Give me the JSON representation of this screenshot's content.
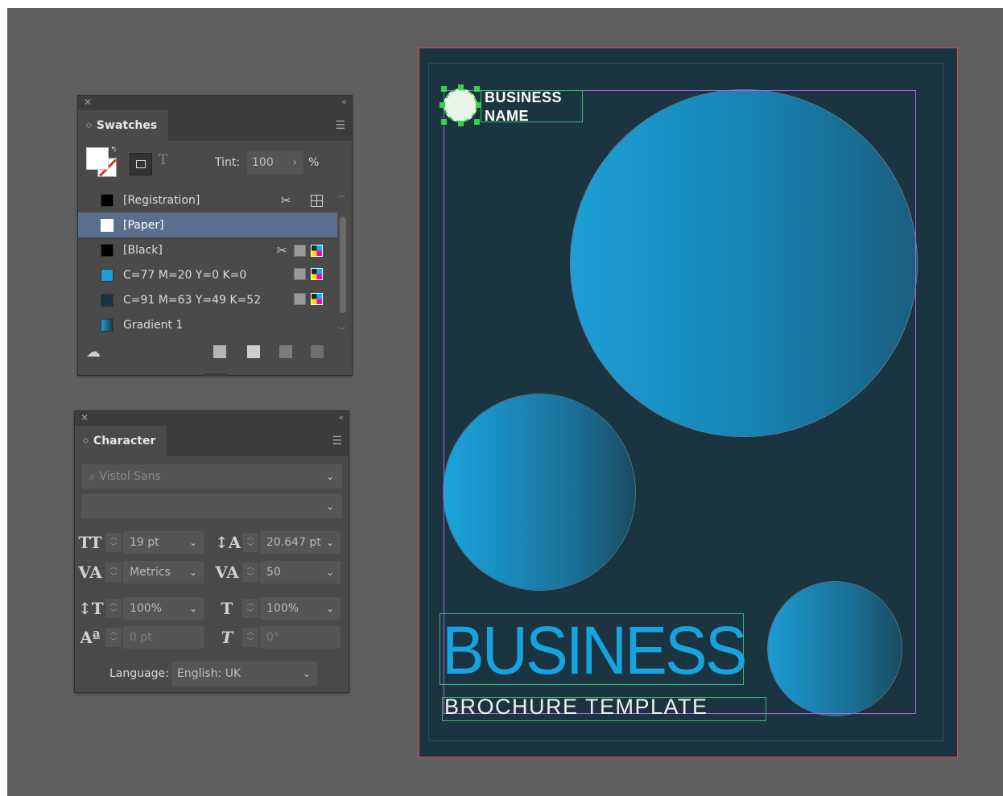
{
  "swatches_panel": {
    "title": "Swatches",
    "tint_label": "Tint:",
    "tint_value": "100",
    "tint_unit": "%",
    "items": [
      {
        "name": "[Registration]",
        "color": "#000000"
      },
      {
        "name": "[Paper]",
        "color": "#ffffff",
        "selected": true
      },
      {
        "name": "[Black]",
        "color": "#000000"
      },
      {
        "name": "C=77 M=20 Y=0 K=0",
        "color": "#1a9fd9"
      },
      {
        "name": "C=91 M=63 Y=49 K=52",
        "color": "#1b3442"
      },
      {
        "name": "Gradient 1",
        "color": "gradient"
      }
    ]
  },
  "character_panel": {
    "title": "Character",
    "font_family": "Vistol Sans",
    "font_style": "",
    "font_size": "19 pt",
    "leading": "20.647 pt",
    "kerning": "Metrics",
    "tracking": "50",
    "vertical_scale": "100%",
    "horizontal_scale": "100%",
    "baseline_shift": "0 pt",
    "skew": "0°",
    "language_label": "Language:",
    "language_value": "English: UK"
  },
  "document": {
    "business_name_line1": "BUSINESS",
    "business_name_line2": "NAME",
    "headline": "BUSINESS",
    "subheadline": "BROCHURE TEMPLATE"
  },
  "colors": {
    "page_background": "#1b3442",
    "accent_blue": "#16a3de",
    "selection_green": "#35d840",
    "margin_guide": "#b060e8",
    "bleed_red": "#e0464a"
  }
}
